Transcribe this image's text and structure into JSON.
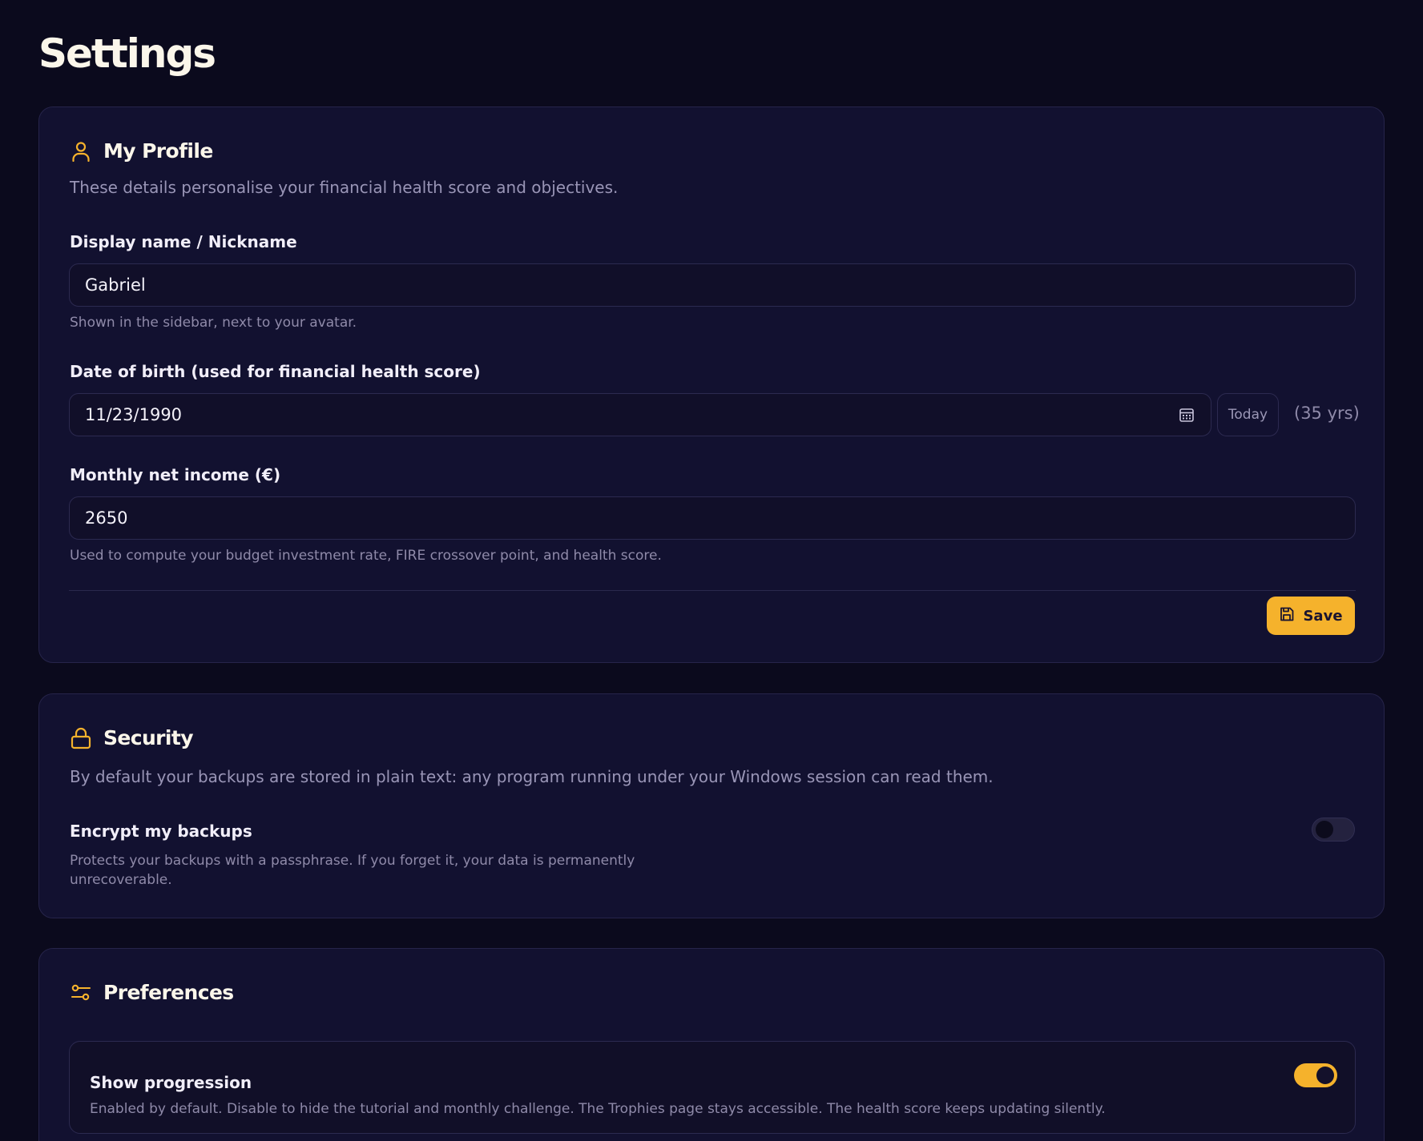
{
  "page": {
    "title": "Settings"
  },
  "profile": {
    "heading": "My Profile",
    "icon": "user-icon",
    "description": "These details personalise your financial health score and objectives.",
    "display_name": {
      "label": "Display name / Nickname",
      "value": "Gabriel",
      "hint": "Shown in the sidebar, next to your avatar."
    },
    "dob": {
      "label": "Date of birth (used for financial health score)",
      "value": "11/23/1990",
      "today_label": "Today",
      "age_text": "(35 yrs)"
    },
    "income": {
      "label": "Monthly net income (€)",
      "value": "2650",
      "hint": "Used to compute your budget investment rate, FIRE crossover point, and health score."
    },
    "save_label": "Save"
  },
  "security": {
    "heading": "Security",
    "icon": "lock-icon",
    "description": "By default your backups are stored in plain text: any program running under your Windows session can read them.",
    "encrypt": {
      "label": "Encrypt my backups",
      "hint": "Protects your backups with a passphrase. If you forget it, your data is permanently unrecoverable.",
      "enabled": false
    }
  },
  "preferences": {
    "heading": "Preferences",
    "icon": "sliders-icon",
    "show_progression": {
      "label": "Show progression",
      "hint": "Enabled by default. Disable to hide the tutorial and monthly challenge. The Trophies page stays accessible. The health score keeps updating silently.",
      "enabled": true
    }
  },
  "colors": {
    "background": "#0b0a1d",
    "card": "#121130",
    "accent": "#f5b22c"
  }
}
